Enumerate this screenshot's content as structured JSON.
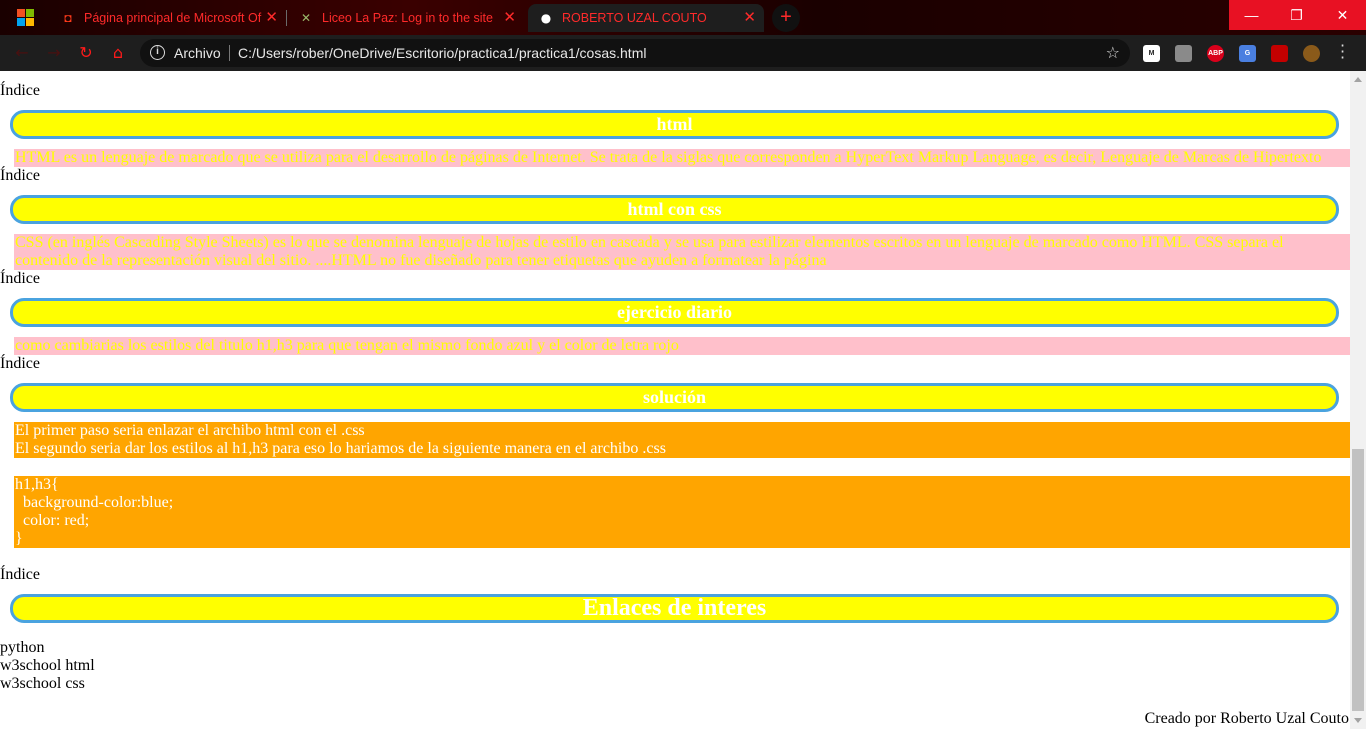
{
  "browser": {
    "tabs": [
      {
        "title": "Página principal de Microsoft Of",
        "close": "✕"
      },
      {
        "title": "Liceo La Paz: Log in to the site",
        "close": "✕"
      },
      {
        "title": "ROBERTO UZAL COUTO",
        "close": "✕"
      }
    ],
    "new_tab": "+",
    "address": {
      "scheme": "Archivo",
      "url": "C:/Users/rober/OneDrive/Escritorio/practica1/practica1/cosas.html"
    },
    "extensions": [
      {
        "name": "mega-extension-icon",
        "label": "M",
        "color": "#ffffff",
        "text_color": "#222222"
      },
      {
        "name": "pdf-extension-icon",
        "label": "",
        "color": "#8a8a8a",
        "text_color": "#ffffff"
      },
      {
        "name": "adblock-plus-icon",
        "label": "ABP",
        "color": "#d9001b",
        "text_color": "#ffffff"
      },
      {
        "name": "google-translate-icon",
        "label": "G",
        "color": "#4a7fe0",
        "text_color": "#ffffff"
      },
      {
        "name": "puzzle-extension-icon",
        "label": "",
        "color": "#c40000",
        "text_color": "#ffffff"
      },
      {
        "name": "profile-avatar-icon",
        "label": "",
        "color": "#8a5a1a",
        "text_color": "#ffffff"
      }
    ]
  },
  "page": {
    "index_label": "Índice",
    "sections": [
      {
        "heading": "html",
        "body": "HTML es un lenguaje de marcado que se utiliza para el desarrollo de páginas de Internet. Se trata de la siglas que corresponden a HyperText Markup Language, es decir, Lenguaje de Marcas de Hipertexto"
      },
      {
        "heading": "html con css",
        "body_line1": "CSS (en inglés Cascading Style Sheets) es lo que se denomina lenguaje de hojas de estilo en cascada y se usa para estilizar elementos escritos en un lenguaje de marcado como HTML. CSS separa el",
        "body_line2": "contenido de la representación visual del sitio. ....HTML no fue diseñado para tener etiquetas que ayuden a formatear la página"
      },
      {
        "heading": "ejercicio diario",
        "body": "como cambiarias los estilos del titulo h1,h3 para que tengan el mismo fondo azul y el color de letra rojo"
      },
      {
        "heading": "solución",
        "line1": "El primer paso seria enlazar el archibo html con el .css",
        "line2": "El segundo seria dar los estilos al h1,h3 para eso lo hariamos de la siguiente manera en el archibo .css",
        "code": [
          "h1,h3{",
          "  background-color:blue;",
          "  color: red;",
          "}"
        ]
      }
    ],
    "links_heading": "Enlaces de interes",
    "links": [
      "python",
      "w3school html",
      "w3school css"
    ],
    "footer": "Creado por Roberto Uzal Couto"
  }
}
